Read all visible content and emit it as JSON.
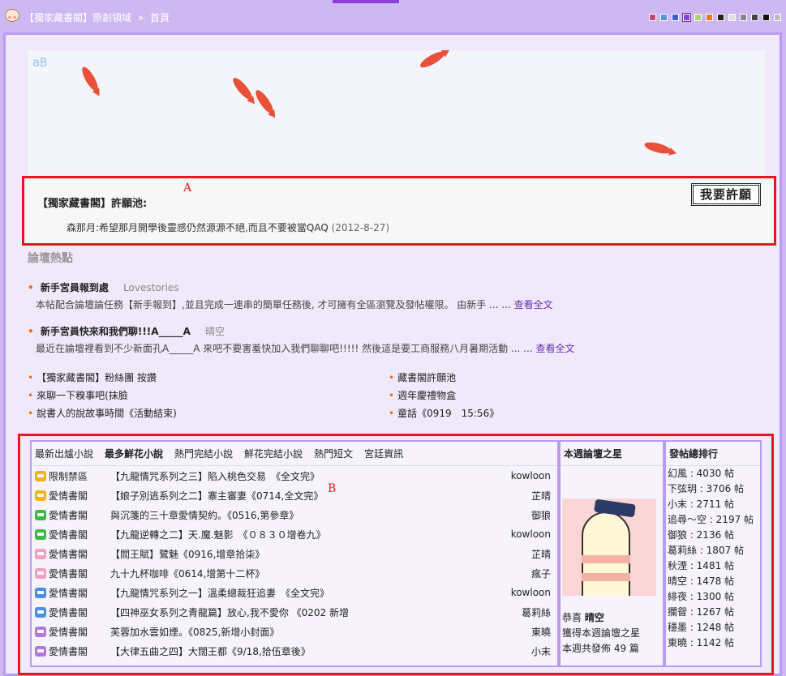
{
  "topbar": {
    "crumbs": [
      "【獨家藏書閣】原創領域",
      "首頁"
    ],
    "crumb_sep": "»",
    "swatches": [
      "#c8477a",
      "#5590e8",
      "#3b5fd6",
      "#8c3fe0",
      "#a8d86a",
      "#f07a16",
      "#222222",
      "#dddddd",
      "#888888",
      "#444444",
      "#111111",
      "#bbbbbb"
    ],
    "active_swatch": 3
  },
  "banner": {
    "logo": "aB"
  },
  "wish": {
    "title": "【獨家藏書閣】許願池:",
    "author": "森那月",
    "message": ":希望那月開學後靈感仍然源源不絕,而且不要被當QAQ",
    "date": "(2012-8-27)",
    "button": "我要許願",
    "marker": "A"
  },
  "hot": {
    "title": "論壇熱點",
    "items": [
      {
        "title": "新手宮員報到處",
        "author": "Lovestories",
        "desc": "本帖配合論壇論任務【新手報到】,並且完成一連串的簡單任務後, 才可擁有全區瀏覽及發帖權限。 由新手 ... ...",
        "more": "查看全文"
      },
      {
        "title": "新手宮員快來和我們聊!!!A_____A",
        "author": "晴空",
        "desc": "最近在論壇裡看到不少新面孔A_____A 來吧不要害羞快加入我們聊聊吧!!!!! 然後這是要工商服務八月暑期活動 ... ...",
        "more": "查看全文"
      }
    ],
    "links": [
      "【獨家藏書閣】粉絲團 按讚",
      "藏書閣許願池",
      "來聊一下糗事吧(抹臉",
      "週年慶禮物盒",
      "說書人的說故事時間《活動結束)",
      "童話《0919　15:56》"
    ]
  },
  "board": {
    "marker": "B",
    "tabs": [
      "最新出爐小說",
      "最多鮮花小說",
      "熱門完結小說",
      "鮮花完結小說",
      "熱門短文",
      "宮廷資訊"
    ],
    "active_tab": 1,
    "rows": [
      {
        "icon_color": "#f2b21b",
        "forum": "限制禁區",
        "topic": "【九龍情咒系列之三】陷入桃色交易　《全文完》",
        "who": "kowloon"
      },
      {
        "icon_color": "#f2b21b",
        "forum": "愛情書閣",
        "topic": "【娘子別逃系列之二】寨主審妻《0714,全文完》",
        "who": "芷晴"
      },
      {
        "icon_color": "#3fb84a",
        "forum": "愛情書閣",
        "topic": "與沉箋的三十章愛情契約。《0516,第參章》",
        "who": "御狼"
      },
      {
        "icon_color": "#3fb84a",
        "forum": "愛情書閣",
        "topic": "【九龍逆轉之二】天.魔.魅影　《０８３０增卷九》",
        "who": "kowloon"
      },
      {
        "icon_color": "#f3a0bc",
        "forum": "愛情書閣",
        "topic": "【閻王賦】鷺魅《0916,增章拾柒》",
        "who": "芷晴"
      },
      {
        "icon_color": "#f3a0bc",
        "forum": "愛情書閣",
        "topic": "九十九杯咖啡《0614,增第十二杯》",
        "who": "瘋子"
      },
      {
        "icon_color": "#4a8fe0",
        "forum": "愛情書閣",
        "topic": "【九龍情咒系列之一】溫柔總裁狂追妻　《全文完》",
        "who": "kowloon"
      },
      {
        "icon_color": "#4a8fe0",
        "forum": "愛情書閣",
        "topic": "【四神巫女系列之青龍篇】放心,我不愛你 《0202 新增",
        "who": "葛莉絲"
      },
      {
        "icon_color": "#b07ad8",
        "forum": "愛情書閣",
        "topic": "芙蓉加水雲如煙。《0825,新增小封面》",
        "who": "東曉"
      },
      {
        "icon_color": "#b07ad8",
        "forum": "愛情書閣",
        "topic": "【大律五曲之四】大闊王都《9/18,拾伍章後》",
        "who": "小末"
      }
    ],
    "star": {
      "title": "本週論壇之星",
      "congrats": "恭喜",
      "name": "晴空",
      "line2": "獲得本週論壇之星",
      "line3": "本週共發佈 49 篇"
    },
    "ranking": {
      "title": "發帖總排行",
      "rows": [
        "幻風 : 4030 帖",
        "下弦玥 : 3706 帖",
        "小末 : 2711 帖",
        "追尋～空 : 2197 帖",
        "御狼 : 2136 帖",
        "葛莉絲 : 1807 帖",
        "秋湮 : 1481 帖",
        "晴空 : 1478 帖",
        "緋夜 : 1300 帖",
        "攔眢 : 1267 帖",
        "穩墨 : 1248 帖",
        "東曉 : 1142 帖"
      ]
    }
  }
}
